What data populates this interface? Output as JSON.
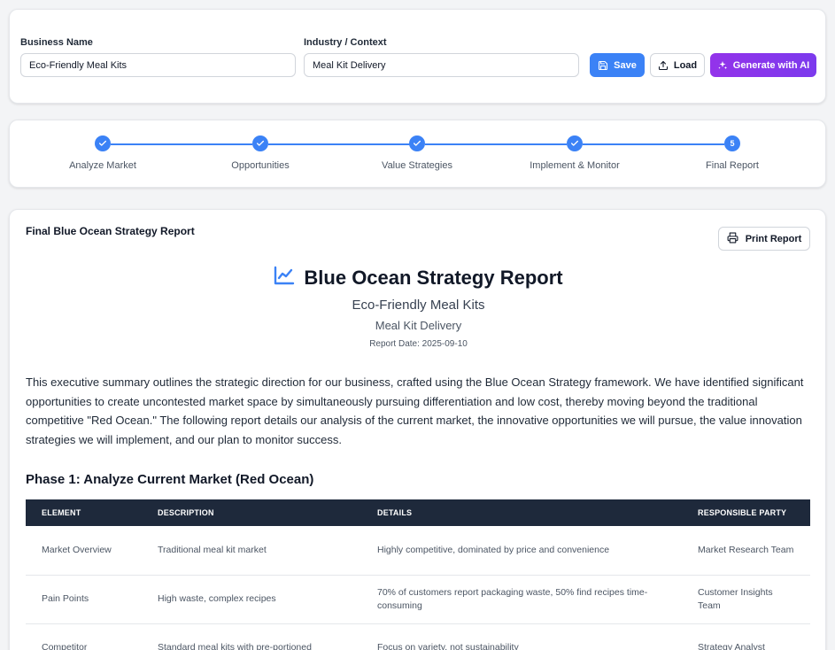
{
  "form": {
    "business_name_label": "Business Name",
    "business_name_value": "Eco-Friendly Meal Kits",
    "industry_label": "Industry / Context",
    "industry_value": "Meal Kit Delivery",
    "save_label": "Save",
    "load_label": "Load",
    "ai_label": "Generate with AI",
    "accent_color": "#3b82f6",
    "ai_color": "#9333ea"
  },
  "stepper": {
    "steps": [
      {
        "label": "Analyze Market",
        "state": "done",
        "icon": "check-icon"
      },
      {
        "label": "Opportunities",
        "state": "done",
        "icon": "check-icon"
      },
      {
        "label": "Value Strategies",
        "state": "done",
        "icon": "check-icon"
      },
      {
        "label": "Implement & Monitor",
        "state": "done",
        "icon": "check-icon"
      },
      {
        "label": "Final Report",
        "state": "current",
        "number": "5"
      }
    ]
  },
  "report": {
    "heading": "Final Blue Ocean Strategy Report",
    "print_label": "Print Report",
    "title": "Blue Ocean Strategy Report",
    "title_icon": "chart-line-icon",
    "business": "Eco-Friendly Meal Kits",
    "industry": "Meal Kit Delivery",
    "date": "Report Date: 2025-09-10",
    "summary": "This executive summary outlines the strategic direction for our business, crafted using the Blue Ocean Strategy framework. We have identified significant opportunities to create uncontested market space by simultaneously pursuing differentiation and low cost, thereby moving beyond the traditional competitive \"Red Ocean.\" The following report details our analysis of the current market, the innovative opportunities we will pursue, the value innovation strategies we will implement, and our plan to monitor success.",
    "phase1_heading": "Phase 1: Analyze Current Market (Red Ocean)",
    "table": {
      "headers": [
        "ELEMENT",
        "DESCRIPTION",
        "DETAILS",
        "RESPONSIBLE PARTY"
      ],
      "rows": [
        [
          "Market Overview",
          "Traditional meal kit market",
          "Highly competitive, dominated by price and convenience",
          "Market Research Team"
        ],
        [
          "Pain Points",
          "High waste, complex recipes",
          "70% of customers report packaging waste, 50% find recipes time-consuming",
          "Customer Insights Team"
        ],
        [
          "Competitor",
          "Standard meal kits with pre-portioned",
          "Focus on variety, not sustainability",
          "Strategy Analyst"
        ]
      ]
    }
  }
}
